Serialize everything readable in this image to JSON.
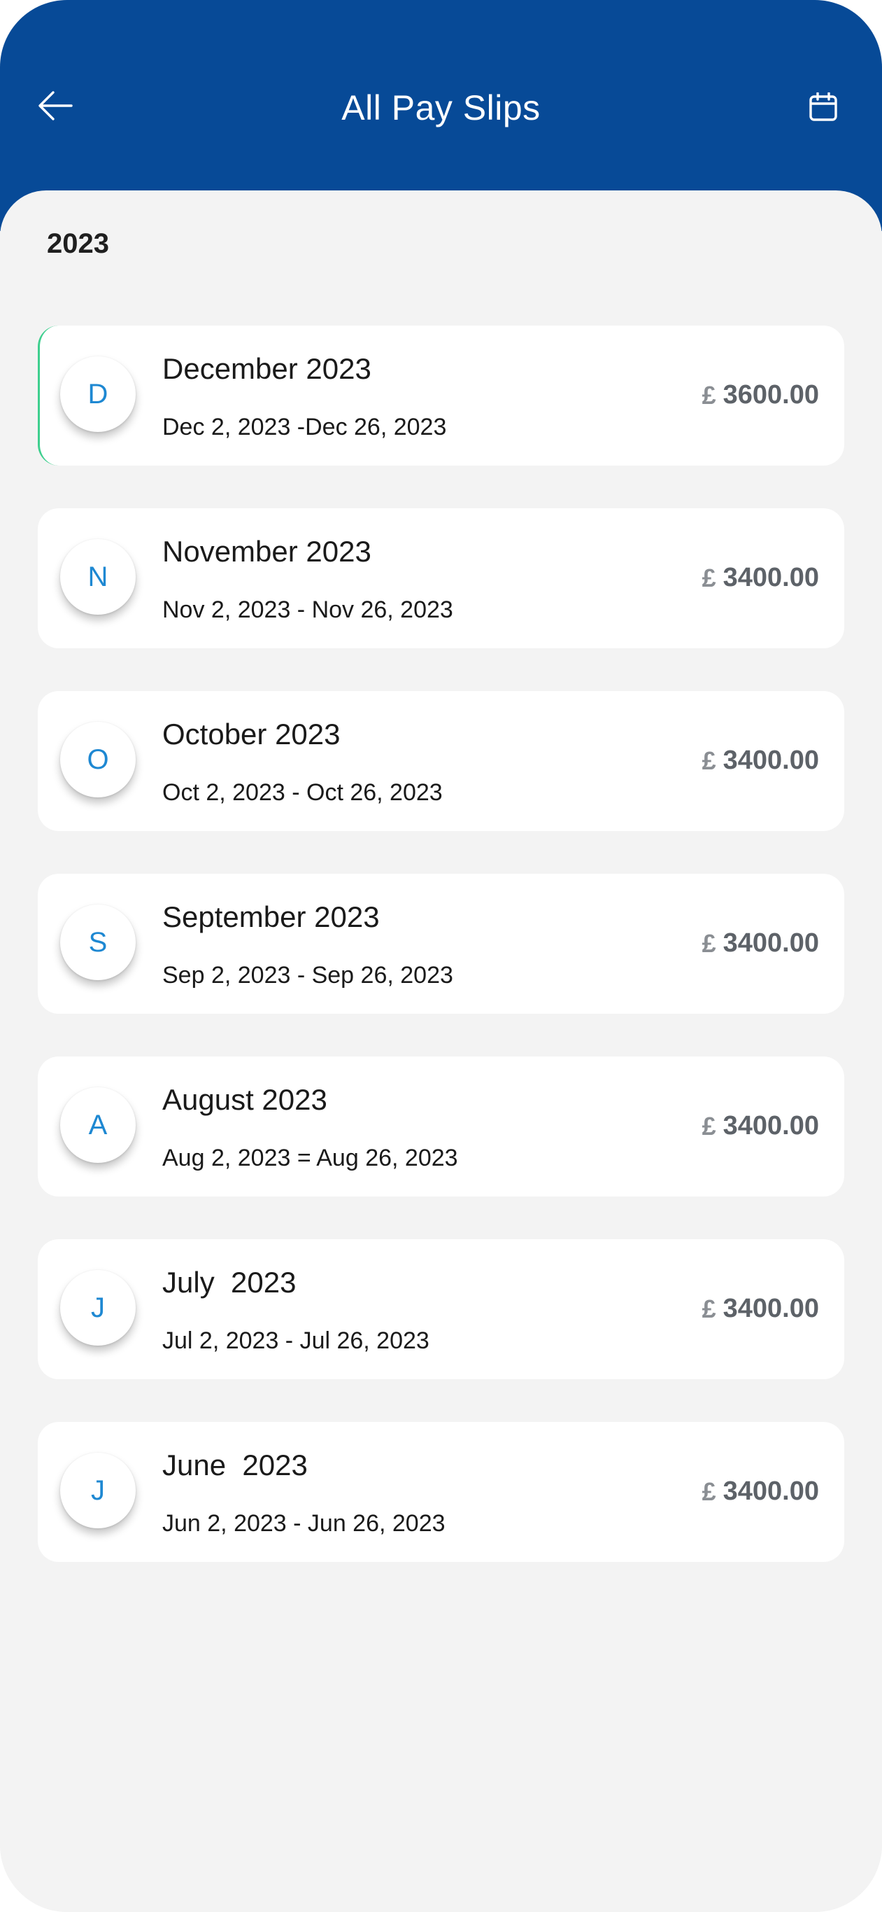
{
  "header": {
    "title": "All Pay Slips",
    "back_icon": "arrow-left-icon",
    "calendar_icon": "calendar-icon"
  },
  "year_label": "2023",
  "payslips": [
    {
      "initial": "D",
      "month": "December 2023",
      "range": "Dec 2, 2023 -Dec 26, 2023",
      "currency": "£",
      "amount": "3600.00"
    },
    {
      "initial": "N",
      "month": "November 2023",
      "range": "Nov 2, 2023 - Nov 26, 2023",
      "currency": "£",
      "amount": "3400.00"
    },
    {
      "initial": "O",
      "month": "October 2023",
      "range": "Oct 2, 2023 - Oct 26, 2023",
      "currency": "£",
      "amount": "3400.00"
    },
    {
      "initial": "S",
      "month": "September 2023",
      "range": "Sep 2, 2023 - Sep 26, 2023",
      "currency": "£",
      "amount": "3400.00"
    },
    {
      "initial": "A",
      "month": "August 2023",
      "range": "Aug 2, 2023 = Aug 26, 2023",
      "currency": "£",
      "amount": "3400.00"
    },
    {
      "initial": "J",
      "month": "July  2023",
      "range": "Jul 2, 2023 - Jul 26, 2023",
      "currency": "£",
      "amount": "3400.00"
    },
    {
      "initial": "J",
      "month": "June  2023",
      "range": "Jun 2, 2023 - Jun 26, 2023",
      "currency": "£",
      "amount": "3400.00"
    }
  ],
  "colors": {
    "header_bg": "#074a97",
    "page_bg": "#f3f3f3",
    "avatar_letter": "#1e88d2",
    "active_indicator": "#3ecf8e",
    "amount_text": "#5d6268"
  }
}
